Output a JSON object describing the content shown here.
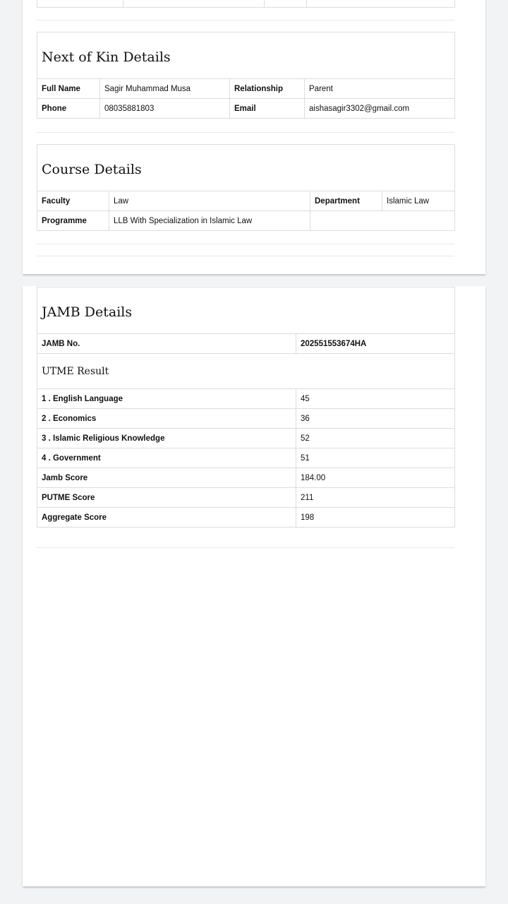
{
  "next_of_kin": {
    "title": "Next of Kin Details",
    "full_name_label": "Full Name",
    "full_name": "Sagir Muhammad Musa",
    "relationship_label": "Relationship",
    "relationship": "Parent",
    "phone_label": "Phone",
    "phone": "08035881803",
    "email_label": "Email",
    "email": "aishasagir3302@gmail.com"
  },
  "course": {
    "title": "Course Details",
    "faculty_label": "Faculty",
    "faculty": "Law",
    "department_label": "Department",
    "department": "Islamic Law",
    "programme_label": "Programme",
    "programme": "LLB With Specialization in Islamic Law"
  },
  "jamb": {
    "title": "JAMB Details",
    "jamb_no_label": "JAMB No.",
    "jamb_no": "202551553674HA",
    "utme_title": "UTME Result",
    "subjects": [
      {
        "name": "1 . English Language",
        "score": "45"
      },
      {
        "name": "2 . Economics",
        "score": "36"
      },
      {
        "name": "3 . Islamic Religious Knowledge",
        "score": "52"
      },
      {
        "name": "4 . Government",
        "score": "51"
      }
    ],
    "jamb_score_label": "Jamb Score",
    "jamb_score": "184.00",
    "putme_score_label": "PUTME Score",
    "putme_score": "211",
    "aggregate_label": "Aggregate Score",
    "aggregate": "198"
  }
}
